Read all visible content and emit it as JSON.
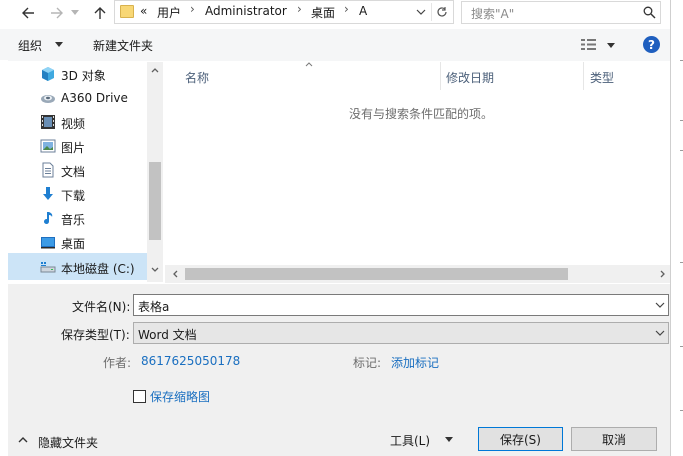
{
  "address_bar": {
    "crumbs": [
      "«",
      "用户",
      "Administrator",
      "桌面",
      "A"
    ],
    "search_placeholder": "搜索\"A\""
  },
  "toolbar": {
    "organize_label": "组织",
    "new_folder_label": "新建文件夹"
  },
  "nav": {
    "items": [
      {
        "label": "3D 对象",
        "icon": "3d-objects-icon"
      },
      {
        "label": "A360 Drive",
        "icon": "a360-drive-icon"
      },
      {
        "label": "视频",
        "icon": "video-icon"
      },
      {
        "label": "图片",
        "icon": "pictures-icon"
      },
      {
        "label": "文档",
        "icon": "documents-icon"
      },
      {
        "label": "下载",
        "icon": "download-icon"
      },
      {
        "label": "音乐",
        "icon": "music-icon"
      },
      {
        "label": "桌面",
        "icon": "desktop-icon"
      },
      {
        "label": "本地磁盘 (C:)",
        "icon": "local-disk-icon",
        "selected": true
      }
    ]
  },
  "file_list": {
    "columns": [
      "名称",
      "修改日期",
      "类型"
    ],
    "empty_message": "没有与搜索条件匹配的项。"
  },
  "form": {
    "filename_label": "文件名(N):",
    "filename_value": "表格a",
    "filetype_label": "保存类型(T):",
    "filetype_value": "Word 文档",
    "author_label": "作者:",
    "author_value": "8617625050178",
    "tags_label": "标记:",
    "tags_value": "添加标记",
    "thumbnail_label": "保存缩略图"
  },
  "footer": {
    "hide_folders_label": "隐藏文件夹",
    "tools_label": "工具(L)",
    "save_label": "保存(S)",
    "cancel_label": "取消"
  },
  "colors": {
    "accent": "#0078d7",
    "selection": "#cce4f7",
    "link": "#1a6fc0"
  }
}
